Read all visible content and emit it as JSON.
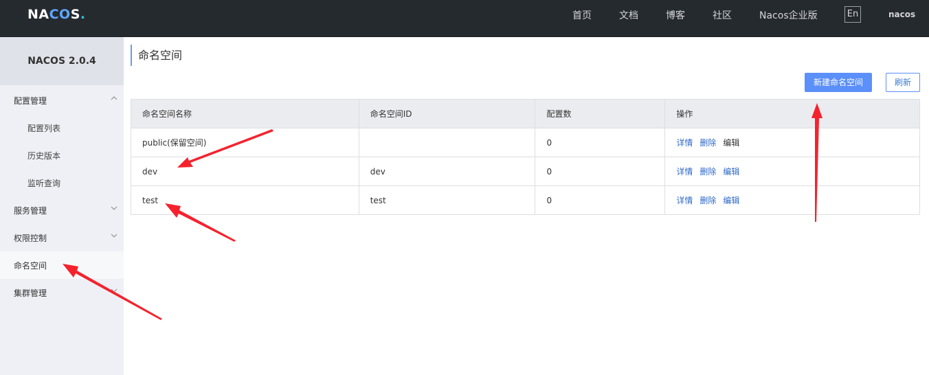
{
  "header": {
    "logo": {
      "na": "NA",
      "co": "CO",
      "s": "S",
      "dot": "."
    },
    "nav": [
      "首页",
      "文档",
      "博客",
      "社区",
      "Nacos企业版"
    ],
    "lang": "En",
    "user": "nacos"
  },
  "sidebar": {
    "title": "NACOS 2.0.4",
    "items": [
      {
        "label": "配置管理"
      },
      {
        "label": "配置列表"
      },
      {
        "label": "历史版本"
      },
      {
        "label": "监听查询"
      },
      {
        "label": "服务管理"
      },
      {
        "label": "权限控制"
      },
      {
        "label": "命名空间"
      },
      {
        "label": "集群管理"
      }
    ]
  },
  "main": {
    "title": "命名空间",
    "new_button": "新建命名空间",
    "refresh_button": "刷新",
    "table": {
      "headers": [
        "命名空间名称",
        "命名空间ID",
        "配置数",
        "操作"
      ],
      "rows": [
        {
          "name": "public(保留空间)",
          "id": "",
          "count": "0"
        },
        {
          "name": "dev",
          "id": "dev",
          "count": "0"
        },
        {
          "name": "test",
          "id": "test",
          "count": "0"
        }
      ],
      "ops": {
        "detail": "详情",
        "delete": "删除",
        "edit": "编辑"
      }
    }
  },
  "colors": {
    "header_bg": "#252a2f",
    "primary": "#5b8ff9",
    "link": "#2f68c8",
    "arrow": "#f5222d"
  }
}
